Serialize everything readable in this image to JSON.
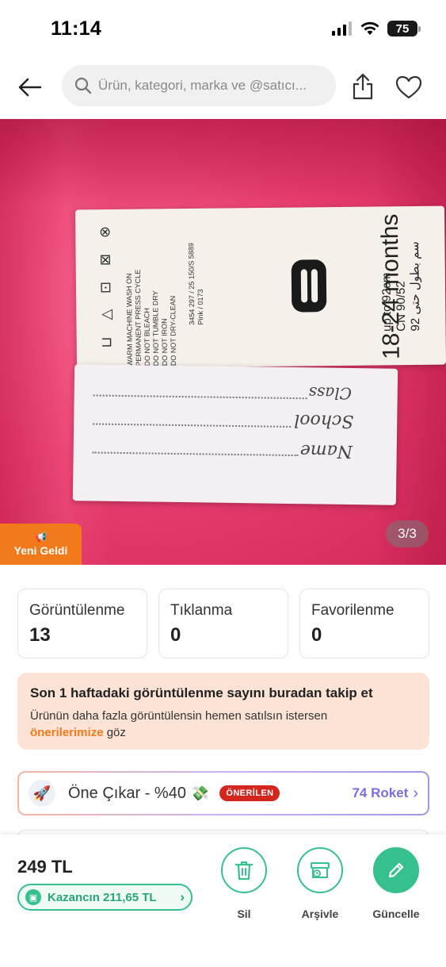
{
  "status_bar": {
    "time": "11:14",
    "battery": "75"
  },
  "header": {
    "search_placeholder": "Ürün, kategori, marka ve @satıcı..."
  },
  "product_image": {
    "care_text": [
      "WARM MACHINE WASH ON",
      "PERMANENT PRESS CYCLE",
      "DO NOT BLEACH",
      "DO NOT TUMBLE DRY",
      "DO NOT IRON",
      "DO NOT DRY-CLEAN"
    ],
    "care_code": [
      "3454 297 / 25 150/S 5889",
      "Pink / 0173"
    ],
    "size_main": "18-24 months",
    "size_sub": [
      "up to 92cm",
      "CN 90/52",
      "92 سم بطول حتى"
    ],
    "name_label_fields": [
      "Name",
      "School",
      "Class"
    ],
    "new_badge": "Yeni Geldi",
    "page_indicator": "3/3"
  },
  "stats": [
    {
      "label": "Görüntülenme",
      "value": "13"
    },
    {
      "label": "Tıklanma",
      "value": "0"
    },
    {
      "label": "Favorilenme",
      "value": "0"
    }
  ],
  "info_banner": {
    "title": "Son 1 haftadaki görüntülenme sayını buradan takip et",
    "body_prefix": "Ürünün daha fazla görüntülensin hemen satılsın istersen",
    "link": "önerilerimize",
    "body_suffix": "göz"
  },
  "promote": {
    "label": "Öne Çıkar - %40",
    "badge": "ÖNERİLEN",
    "price": "74 Roket"
  },
  "bottom": {
    "price": "249 TL",
    "earnings": "Kazancın 211,65 TL",
    "actions": [
      {
        "label": "Sil"
      },
      {
        "label": "Arşivle"
      },
      {
        "label": "Güncelle"
      }
    ]
  },
  "colors": {
    "accent_green": "#35c08e",
    "orange": "#f27a1a",
    "purple": "#7b6ee3",
    "badge_red": "#d3261f"
  }
}
